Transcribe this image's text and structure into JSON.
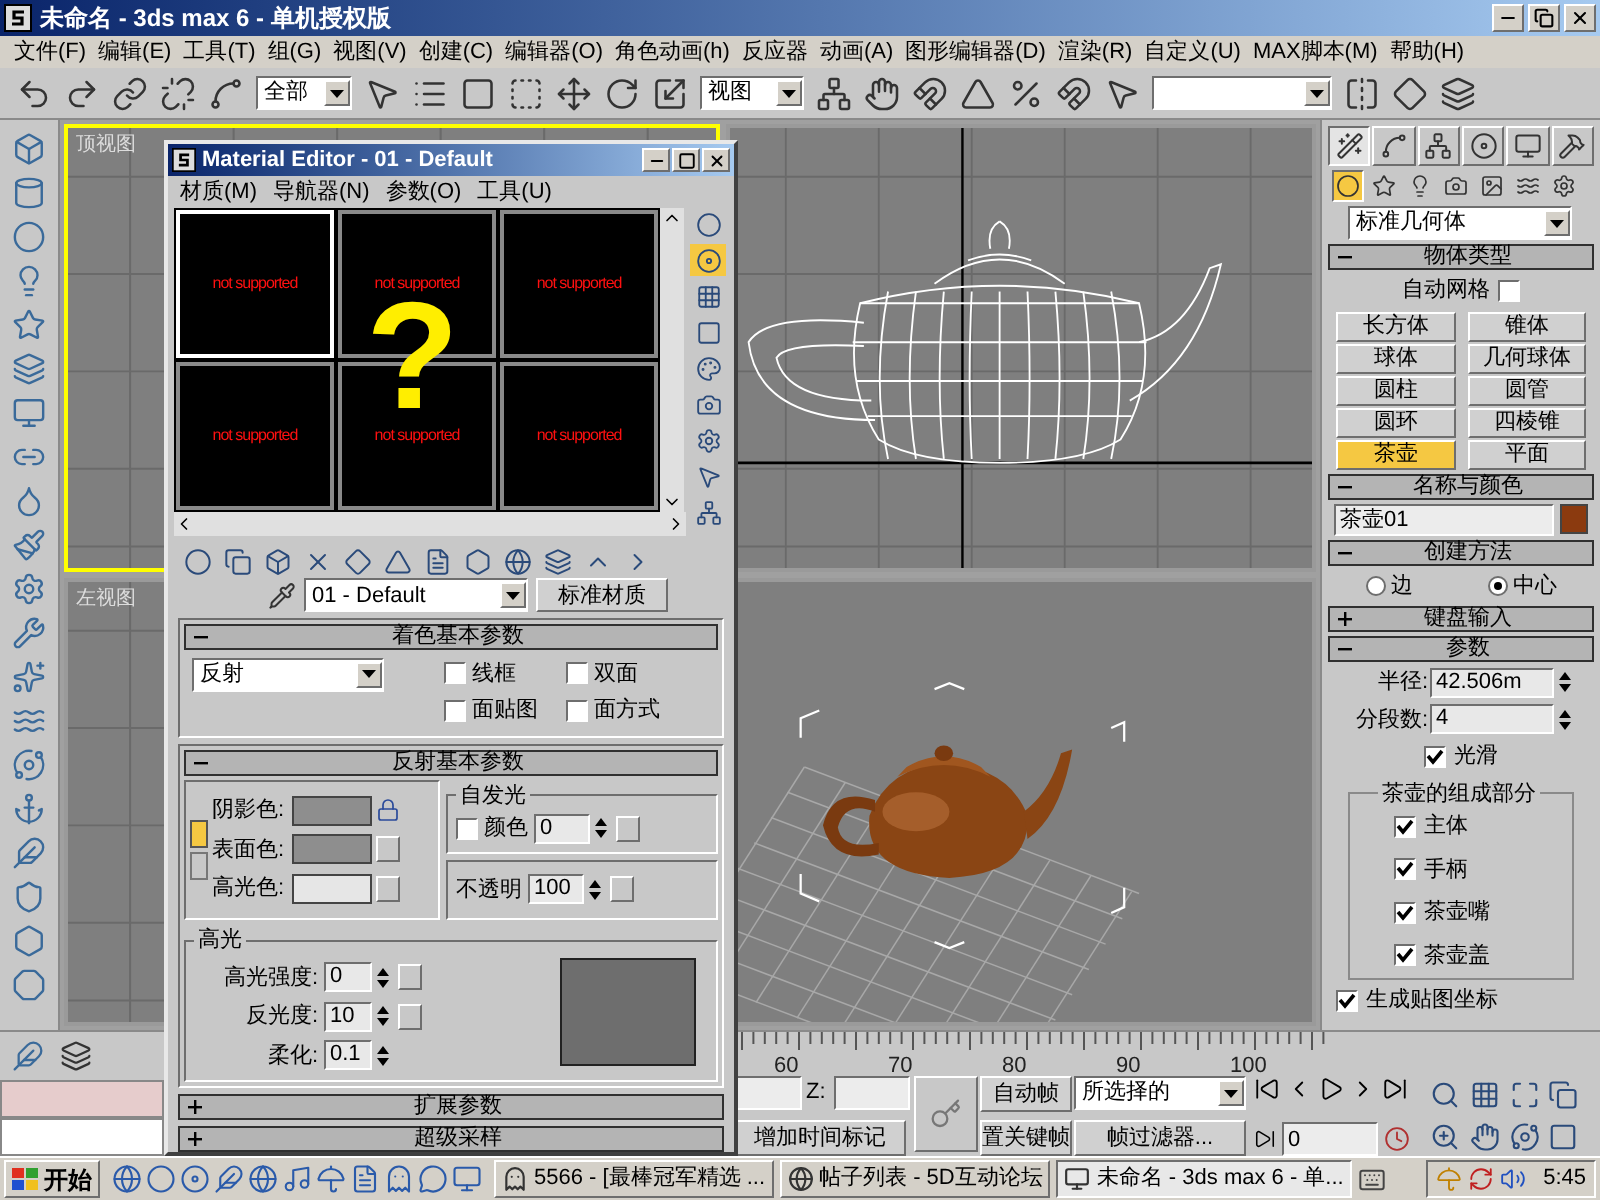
{
  "window": {
    "title": "未命名 - 3ds max 6 - 单机授权版"
  },
  "menu": [
    "文件(F)",
    "编辑(E)",
    "工具(T)",
    "组(G)",
    "视图(V)",
    "创建(C)",
    "编辑器(O)",
    "角色动画(h)",
    "反应器",
    "动画(A)",
    "图形编辑器(D)",
    "渲染(R)",
    "自定义(U)",
    "MAX脚本(M)",
    "帮助(H)"
  ],
  "toolbar": {
    "selection_filter": "全部",
    "coordinate_system": "视图"
  },
  "viewports": [
    {
      "kind": "top",
      "label": "顶视图",
      "selected": true
    },
    {
      "kind": "front",
      "selected": false
    },
    {
      "kind": "left",
      "label": "左视图",
      "selected": false
    },
    {
      "kind": "perspective",
      "selected": false
    }
  ],
  "material_editor": {
    "title": "Material Editor - 01 - Default",
    "menu": [
      "材质(M)",
      "导航器(N)",
      "参数(O)",
      "工具(U)"
    ],
    "slots": [
      {
        "text": "not supported",
        "selected": true
      },
      {
        "text": "not supported",
        "selected": false
      },
      {
        "text": "not supported",
        "selected": false
      },
      {
        "text": "not supported",
        "selected": false
      },
      {
        "text": "not supported",
        "selected": false
      },
      {
        "text": "not supported",
        "selected": false
      }
    ],
    "annotation": "?",
    "material_name": "01 - Default",
    "material_type": "标准材质",
    "shader": {
      "title": "着色基本参数",
      "expanded": true,
      "value": "反射",
      "options": [
        {
          "label": "线框",
          "checked": false
        },
        {
          "label": "双面",
          "checked": false
        },
        {
          "label": "面贴图",
          "checked": false
        },
        {
          "label": "面方式",
          "checked": false
        }
      ]
    },
    "basic": {
      "title": "反射基本参数",
      "expanded": true,
      "colors": [
        {
          "label": "阴影色:",
          "color": "#8e8e8e"
        },
        {
          "label": "表面色:",
          "color": "#8e8e8e"
        },
        {
          "label": "高光色:",
          "color": "#e6e6e6"
        }
      ],
      "self_illumination": {
        "title": "自发光",
        "label": "颜色",
        "checked": false,
        "value": "0"
      },
      "opacity": {
        "label": "不透明",
        "value": "100"
      },
      "highlights": {
        "title": "高光",
        "fields": [
          {
            "label": "高光强度:",
            "value": "0"
          },
          {
            "label": "反光度:",
            "value": "10"
          },
          {
            "label": "柔化:",
            "value": "0.1"
          }
        ]
      }
    },
    "collapsed": [
      {
        "title": "扩展参数",
        "expanded": false
      },
      {
        "title": "超级采样",
        "expanded": false
      }
    ]
  },
  "command_panel": {
    "tabs": [
      {
        "selected": true
      },
      {
        "selected": false
      },
      {
        "selected": false
      },
      {
        "selected": false
      },
      {
        "selected": false
      },
      {
        "selected": false
      }
    ],
    "categories": [
      {
        "selected": true
      },
      {
        "selected": false
      },
      {
        "selected": false
      },
      {
        "selected": false
      },
      {
        "selected": false
      },
      {
        "selected": false
      },
      {
        "selected": false
      }
    ],
    "category": "标准几何体",
    "object_type": {
      "title": "物体类型",
      "expanded": true,
      "autogrid": {
        "label": "自动网格",
        "checked": false
      },
      "buttons": [
        {
          "label": "长方体",
          "selected": false
        },
        {
          "label": "锥体",
          "selected": false
        },
        {
          "label": "球体",
          "selected": false
        },
        {
          "label": "几何球体",
          "selected": false
        },
        {
          "label": "圆柱",
          "selected": false
        },
        {
          "label": "圆管",
          "selected": false
        },
        {
          "label": "圆环",
          "selected": false
        },
        {
          "label": "四棱锥",
          "selected": false
        },
        {
          "label": "茶壶",
          "selected": true
        },
        {
          "label": "平面",
          "selected": false
        }
      ]
    },
    "name_color": {
      "title": "名称与颜色",
      "expanded": true,
      "name": "茶壶01",
      "color": "#8b3a0f"
    },
    "creation_method": {
      "title": "创建方法",
      "expanded": true,
      "options": [
        {
          "label": "边",
          "selected": false
        },
        {
          "label": "中心",
          "selected": true
        }
      ]
    },
    "keyboard_entry": {
      "title": "键盘输入",
      "expanded": false
    },
    "parameters": {
      "title": "参数",
      "expanded": true,
      "radius": {
        "label": "半径:",
        "value": "42.506m"
      },
      "segments": {
        "label": "分段数:",
        "value": "4"
      },
      "smooth": {
        "label": "光滑",
        "checked": true
      },
      "parts": {
        "title": "茶壶的组成部分",
        "items": [
          {
            "label": "主体",
            "checked": true
          },
          {
            "label": "手柄",
            "checked": true
          },
          {
            "label": "茶壶嘴",
            "checked": true
          },
          {
            "label": "茶壶盖",
            "checked": true
          }
        ]
      },
      "mapping": {
        "label": "生成贴图坐标",
        "checked": true
      }
    }
  },
  "timeline": {
    "ticks": [
      "60",
      "70",
      "80",
      "90",
      "100"
    ]
  },
  "bottom": {
    "z_label": "Z:",
    "time_tag": "增加时间标记",
    "auto_key": "自动帧",
    "set_key": "置关键帧",
    "key_mode": "所选择的",
    "key_filters": "帧过滤器...",
    "frame": "0"
  },
  "taskbar": {
    "start": "开始",
    "tasks": [
      {
        "label": "5566 - [最棒冠军精选 ...",
        "selected": false
      },
      {
        "label": "帖子列表 - 5D互动论坛",
        "selected": false
      },
      {
        "label": "未命名 - 3ds max 6 - 单...",
        "selected": true
      }
    ],
    "clock": "5:45"
  }
}
